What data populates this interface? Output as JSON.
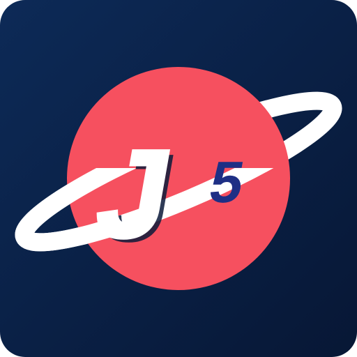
{
  "icon": {
    "logo_text": {
      "letter": "J",
      "superscript": "5"
    },
    "colors": {
      "background_top": "#0d2a57",
      "background_bottom": "#071735",
      "planet": "#f6505f",
      "ring": "#ffffff",
      "letter_fill": "#ffffff",
      "letter_shadow": "#0b1a3a",
      "superscript_fill": "#1e2f85"
    }
  }
}
